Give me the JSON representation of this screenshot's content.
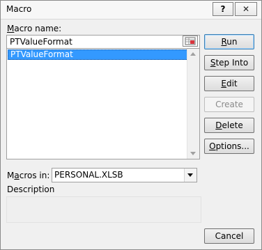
{
  "window": {
    "title": "Macro",
    "help_label": "?",
    "close_label": "✕"
  },
  "macro_name": {
    "label_pre": "",
    "label_key": "M",
    "label_post": "acro name:",
    "value": "PTValueFormat"
  },
  "macro_list": {
    "items": [
      "PTValueFormat"
    ],
    "selected_index": 0
  },
  "buttons": {
    "run": {
      "key": "R",
      "rest": "un"
    },
    "step_into": {
      "key": "S",
      "rest": "tep Into"
    },
    "edit": {
      "key": "E",
      "rest": "dit"
    },
    "create": {
      "label": "Create"
    },
    "delete": {
      "key": "D",
      "rest": "elete"
    },
    "options": {
      "key": "O",
      "rest": "ptions..."
    },
    "cancel": {
      "label": "Cancel"
    }
  },
  "macros_in": {
    "label_pre": "M",
    "label_key": "a",
    "label_post": "cros in:",
    "value": "PERSONAL.XLSB"
  },
  "description": {
    "label": "Description",
    "text": ""
  }
}
